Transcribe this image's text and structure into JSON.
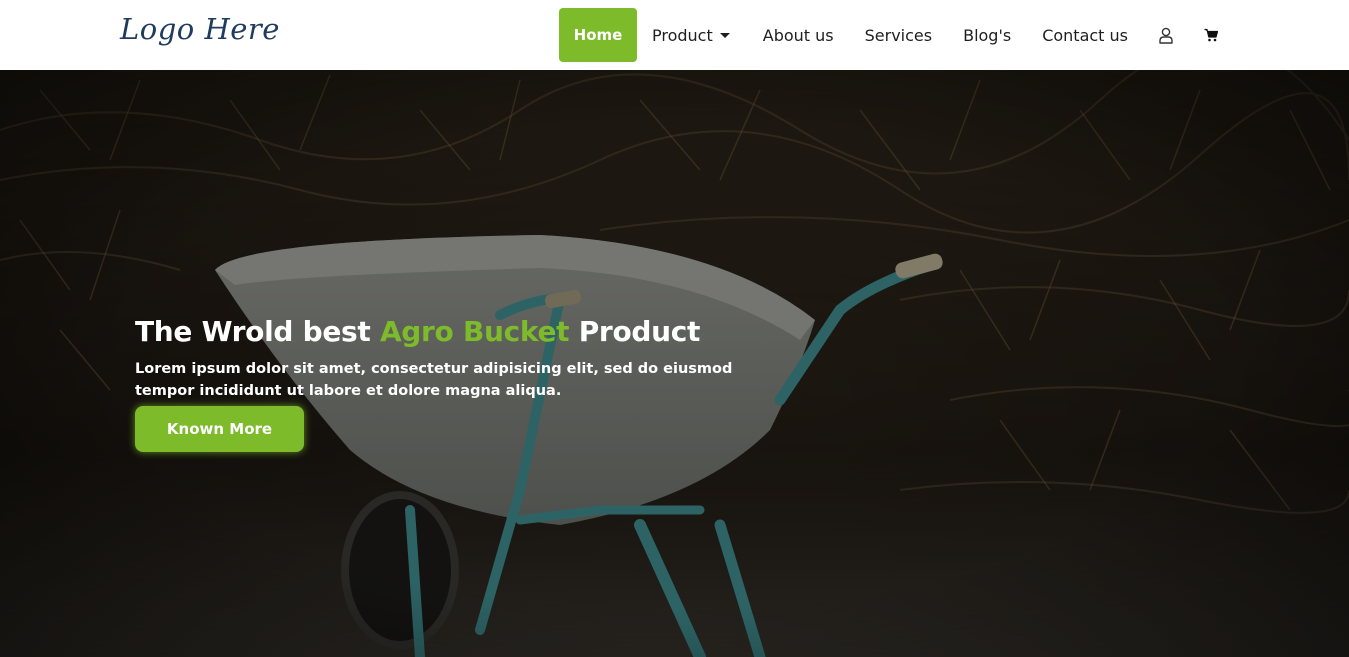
{
  "brand": {
    "logo_text": "Logo Here"
  },
  "nav": {
    "items": [
      {
        "label": "Home"
      },
      {
        "label": "Product"
      },
      {
        "label": "About us"
      },
      {
        "label": "Services"
      },
      {
        "label": "Blog's"
      },
      {
        "label": "Contact us"
      }
    ],
    "icons": [
      "user-icon",
      "cart-icon"
    ]
  },
  "hero": {
    "title_start": "The Wrold best ",
    "title_accent": "Agro Bucket",
    "title_end": " Product",
    "text": "Lorem ipsum dolor sit amet, consectetur adipisicing elit, sed do eiusmod tempor incididunt ut labore et dolore magna aliqua.",
    "button_label": "Known More"
  },
  "colors": {
    "accent": "#7dbb2b",
    "logo": "#1f3b5e",
    "nav_text": "#1f1f1f"
  }
}
